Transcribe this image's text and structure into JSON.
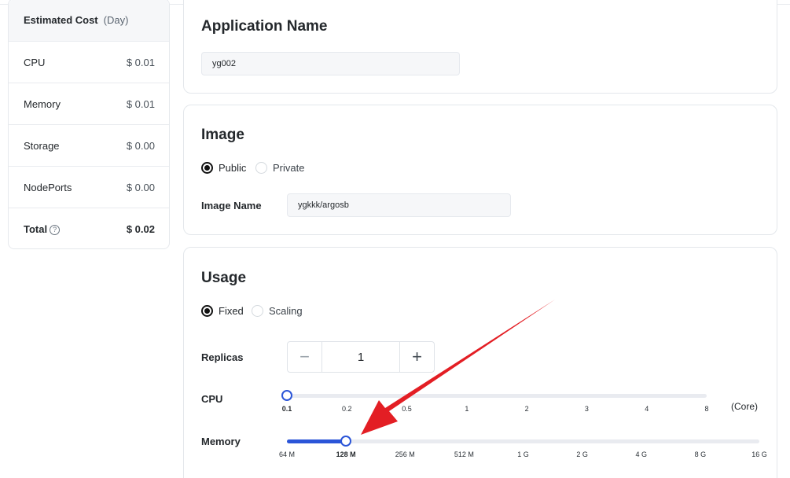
{
  "estimated_cost": {
    "title": "Estimated Cost",
    "period": "(Day)",
    "rows": [
      {
        "label": "CPU",
        "value": "$ 0.01"
      },
      {
        "label": "Memory",
        "value": "$ 0.01"
      },
      {
        "label": "Storage",
        "value": "$ 0.00"
      },
      {
        "label": "NodePorts",
        "value": "$ 0.00"
      }
    ],
    "total": {
      "label": "Total",
      "value": "$ 0.02",
      "help_icon": "?"
    }
  },
  "app_name_section": {
    "title": "Application Name",
    "value": "yg002"
  },
  "image_section": {
    "title": "Image",
    "options": {
      "public": "Public",
      "private": "Private"
    },
    "selected": "Public",
    "image_name_label": "Image Name",
    "image_name_value": "ygkkk/argosb"
  },
  "usage_section": {
    "title": "Usage",
    "modes": {
      "fixed": "Fixed",
      "scaling": "Scaling"
    },
    "selected_mode": "Fixed",
    "replicas": {
      "label": "Replicas",
      "value": "1",
      "minus": "−",
      "plus": "+"
    },
    "cpu": {
      "label": "CPU",
      "ticks": [
        "0.1",
        "0.2",
        "0.5",
        "1",
        "2",
        "3",
        "4",
        "8"
      ],
      "selected": "0.1",
      "unit": "(Core)"
    },
    "memory": {
      "label": "Memory",
      "ticks": [
        "64 M",
        "128 M",
        "256 M",
        "512 M",
        "1 G",
        "2 G",
        "4 G",
        "8 G",
        "16 G"
      ],
      "selected": "128 M"
    }
  },
  "colors": {
    "accent": "#2b55d8",
    "annotation_arrow": "#e31e24"
  }
}
